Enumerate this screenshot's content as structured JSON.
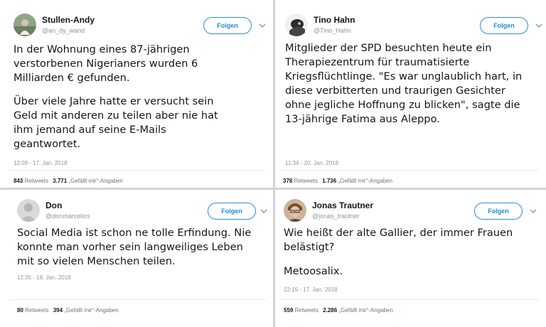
{
  "tweets": [
    {
      "name": "Stullen-Andy",
      "handle": "@an_dy_wand",
      "follow_label": "Folgen",
      "avatar_icon": "avatar-photo",
      "paragraphs": [
        [
          "In der Wohnung eines 87-jährigen",
          "verstorbenen Nigerianers wurden 6",
          "Milliarden € gefunden."
        ],
        [
          "Über viele Jahre hatte er versucht sein",
          "Geld mit anderen zu teilen aber nie hat",
          "ihm jemand auf seine E-Mails",
          "geantwortet."
        ]
      ],
      "time": "12:09 - 17. Jan. 2018",
      "retweets_count": "843",
      "retweets_label": "Retweets",
      "likes_count": "3.771",
      "likes_label": "„Gefällt mir“-Angaben"
    },
    {
      "name": "Tino Hahn",
      "handle": "@Tino_Hahn",
      "follow_label": "Folgen",
      "avatar_icon": "avatar-photo",
      "paragraphs": [
        [
          "Mitglieder der SPD besuchten heute ein",
          "Therapiezentrum für traumatisierte",
          "Kriegsflüchtlinge. \"Es war unglaublich hart, in",
          "diese verbitterten und traurigen Gesichter",
          "ohne jegliche Hoffnung zu blicken\", sagte die",
          "13-jährige Fatima aus Aleppo."
        ]
      ],
      "time": "11:34 - 20. Jan. 2018",
      "retweets_count": "378",
      "retweets_label": "Retweets",
      "likes_count": "1.736",
      "likes_label": "„Gefällt mir“-Angaben"
    },
    {
      "name": "Don",
      "handle": "@donmarcelios",
      "follow_label": "Folgen",
      "avatar_icon": "avatar-photo",
      "paragraphs": [
        [
          "Social Media ist schon ne tolle Erfindung. Nie",
          "konnte man vorher sein langweiliges Leben",
          "mit so vielen Menschen teilen."
        ]
      ],
      "time": "12:35 - 18. Jan. 2018",
      "retweets_count": "80",
      "retweets_label": "Retweets",
      "likes_count": "394",
      "likes_label": "„Gefällt mir“-Angaben"
    },
    {
      "name": "Jonas Trautner",
      "handle": "@jonas_trautner",
      "follow_label": "Folgen",
      "avatar_icon": "avatar-photo",
      "paragraphs": [
        [
          "Wie heißt der alte Gallier, der immer Frauen",
          "belästigt?"
        ],
        [
          "Metoosalix."
        ]
      ],
      "time": "22:19 - 17. Jan. 2018",
      "retweets_count": "559",
      "retweets_label": "Retweets",
      "likes_count": "2.286",
      "likes_label": "„Gefällt mir“-Angaben"
    }
  ],
  "colors": {
    "accent": "#1d8ed8",
    "muted": "#8c96a1",
    "text": "#14171a",
    "divider": "#d4d4d4"
  }
}
